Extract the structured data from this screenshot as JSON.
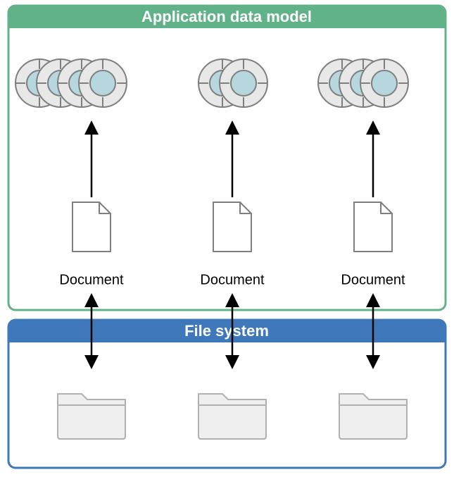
{
  "diagram": {
    "top_panel_title": "Application data model",
    "bottom_panel_title": "File system",
    "columns": [
      {
        "label": "Document",
        "disc_count": 4
      },
      {
        "label": "Document",
        "disc_count": 2
      },
      {
        "label": "Document",
        "disc_count": 3
      }
    ],
    "colors": {
      "top_header": "#62B289",
      "top_border": "#62B289",
      "bottom_header": "#3E78BA",
      "bottom_border": "#3E78BA",
      "disc_outer": "#E8E8E8",
      "disc_inner": "#B7D7DF",
      "disc_stroke": "#7E7E7E",
      "page_stroke": "#7E7E7E",
      "folder_fill": "#EFEFEF",
      "folder_stroke": "#B0B0B0",
      "arrow": "#000000"
    }
  }
}
